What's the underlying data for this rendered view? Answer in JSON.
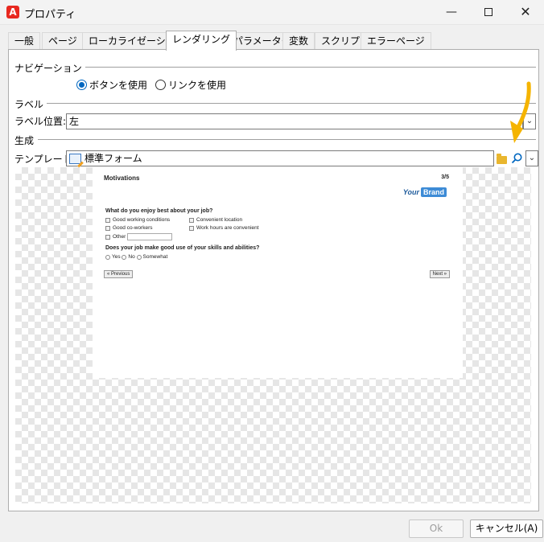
{
  "window": {
    "app_icon": "adobe-a-icon",
    "app_icon_glyph": "A",
    "title": "プロパティ",
    "minimize_glyph": "—",
    "close_glyph": "✕"
  },
  "tabs": [
    {
      "label": "一般"
    },
    {
      "label": "ページ"
    },
    {
      "label": "ローカライゼーション"
    },
    {
      "label": "レンダリング",
      "active": true
    },
    {
      "label": "パラメーター"
    },
    {
      "label": "変数"
    },
    {
      "label": "スクリプト"
    },
    {
      "label": "エラーページ"
    }
  ],
  "navigation": {
    "section_label": "ナビゲーション",
    "option_buttons": "ボタンを使用",
    "option_links": "リンクを使用",
    "selected": "ボタンを使用"
  },
  "label": {
    "section_label": "ラベル",
    "position_label": "ラベル位置:",
    "position_value": "左"
  },
  "generation": {
    "section_label": "生成",
    "template_label": "テンプレート:",
    "template_value": "標準フォーム"
  },
  "preview": {
    "page_title": "Motivations",
    "page_count": "3/5",
    "brand_your": "Your",
    "brand_name": "Brand",
    "q1": "What do you enjoy best about your job?",
    "q1_options": [
      "Good working conditions",
      "Convenient location",
      "Good co-workers",
      "Work hours are convenient",
      "Other"
    ],
    "q2": "Does your job make good use of your skills and abilities?",
    "q2_options": [
      "Yes",
      "No",
      "Somewhat"
    ],
    "prev_button": "« Previous",
    "next_button": "Next »"
  },
  "footer": {
    "ok_label": "Ok",
    "cancel_label": "キャンセル(A)"
  },
  "colors": {
    "accent": "#0067c0",
    "annotation_arrow": "#f5b400"
  }
}
